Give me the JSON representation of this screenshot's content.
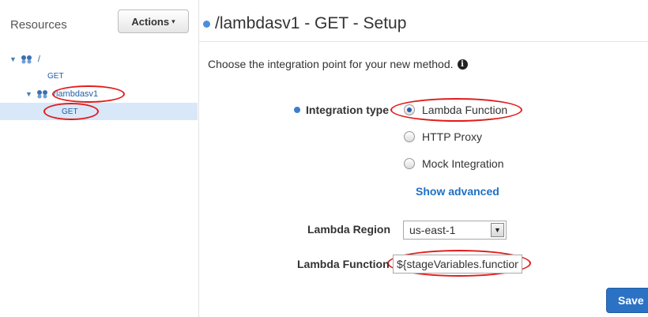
{
  "sidebar": {
    "title": "Resources",
    "actions_label": "Actions",
    "tree": {
      "root_label": "/",
      "root_method": "GET",
      "child_label": "/lambdasv1",
      "child_method": "GET"
    }
  },
  "main": {
    "title": "/lambdasv1 - GET - Setup",
    "instruction": "Choose the integration point for your new method.",
    "integration_type_label": "Integration type",
    "options": [
      {
        "label": "Lambda Function",
        "selected": true
      },
      {
        "label": "HTTP Proxy",
        "selected": false
      },
      {
        "label": "Mock Integration",
        "selected": false
      }
    ],
    "show_advanced": "Show advanced",
    "lambda_region_label": "Lambda Region",
    "lambda_region_value": "us-east-1",
    "lambda_function_label": "Lambda Function",
    "lambda_function_value": "${stageVariables.function}",
    "save_label": "Save"
  },
  "colors": {
    "accent": "#2b72c4",
    "annotation": "#e21b1b",
    "selection": "#d8e8f9"
  }
}
